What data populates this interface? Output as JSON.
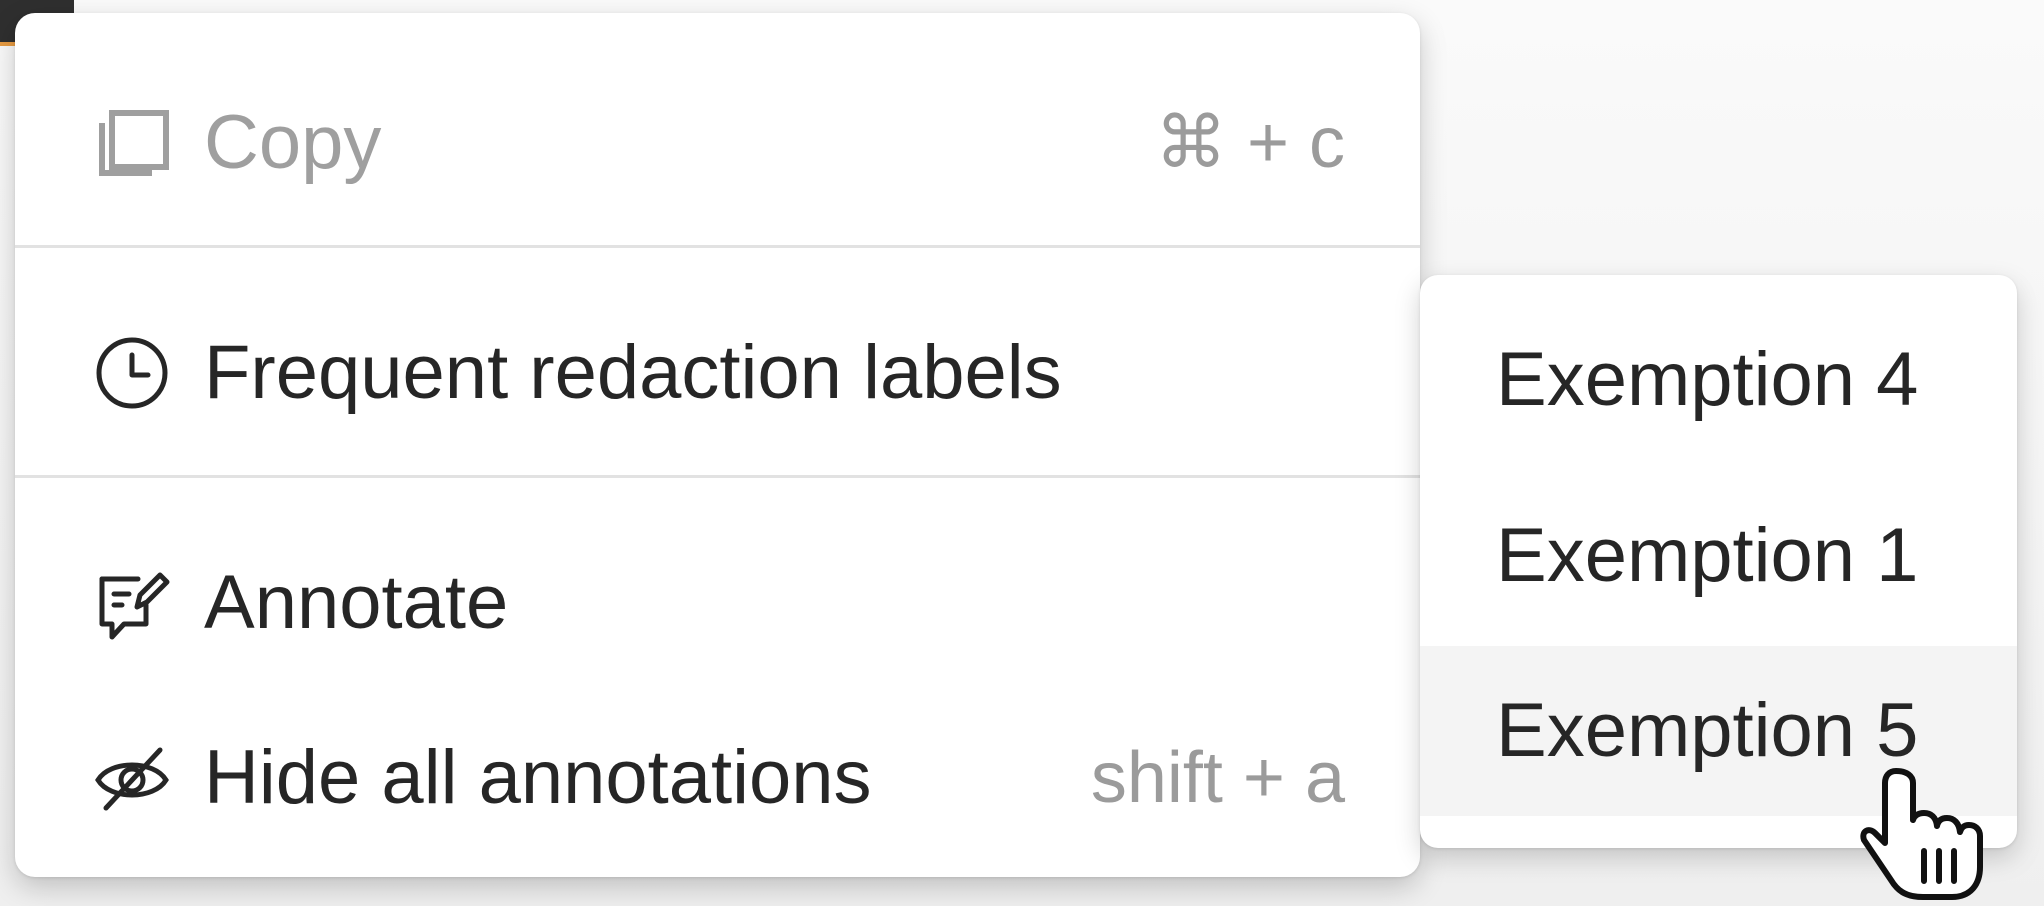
{
  "menu": {
    "items": [
      {
        "label": "Copy",
        "shortcut": "⌘ + c",
        "icon": "copy-icon",
        "disabled": true
      },
      {
        "label": "Frequent redaction labels",
        "shortcut": "",
        "icon": "clock-icon",
        "disabled": false
      },
      {
        "label": "Annotate",
        "shortcut": "",
        "icon": "annotate-icon",
        "disabled": false
      },
      {
        "label": "Hide all annotations",
        "shortcut": "shift + a",
        "icon": "eye-off-icon",
        "disabled": false
      }
    ]
  },
  "submenu": {
    "items": [
      {
        "label": "Exemption 4"
      },
      {
        "label": "Exemption 1"
      },
      {
        "label": "Exemption 5",
        "hovered": true
      }
    ]
  },
  "colors": {
    "text": "#262626",
    "disabled_text": "#9f9f9f",
    "divider": "#e2e2e2",
    "hover_bg": "#f4f4f4",
    "chip": "#2f2f2f",
    "chip_accent": "#e79b42"
  }
}
